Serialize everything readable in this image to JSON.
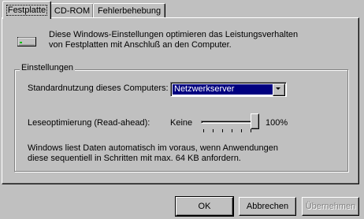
{
  "tabs": [
    {
      "label": "Festplatte",
      "active": true
    },
    {
      "label": "CD-ROM",
      "active": false
    },
    {
      "label": "Fehlerbehebung",
      "active": false
    }
  ],
  "intro": {
    "icon": "hard-drive-icon",
    "line1": "Diese Windows-Einstellungen optimieren das Leistungsverhalten",
    "line2": "von Festplatten mit Anschluß an den Computer."
  },
  "group": {
    "legend": "Einstellungen",
    "usage_label": "Standardnutzung dieses Computers:",
    "usage_value": "Netzwerkserver",
    "readahead_label": "Leseoptimierung (Read-ahead):",
    "readahead_min_label": "Keine",
    "readahead_max_label": "100%",
    "readahead_level_fraction": 1.0,
    "info_line1": "Windows liest Daten automatisch im voraus, wenn Anwendungen",
    "info_line2": "diese sequentiell in Schritten mit max. 64 KB anfordern."
  },
  "buttons": {
    "ok": "OK",
    "cancel": "Abbrechen",
    "apply": "Übernehmen"
  },
  "colors": {
    "face": "#c0c0c0",
    "selection": "#000080"
  }
}
